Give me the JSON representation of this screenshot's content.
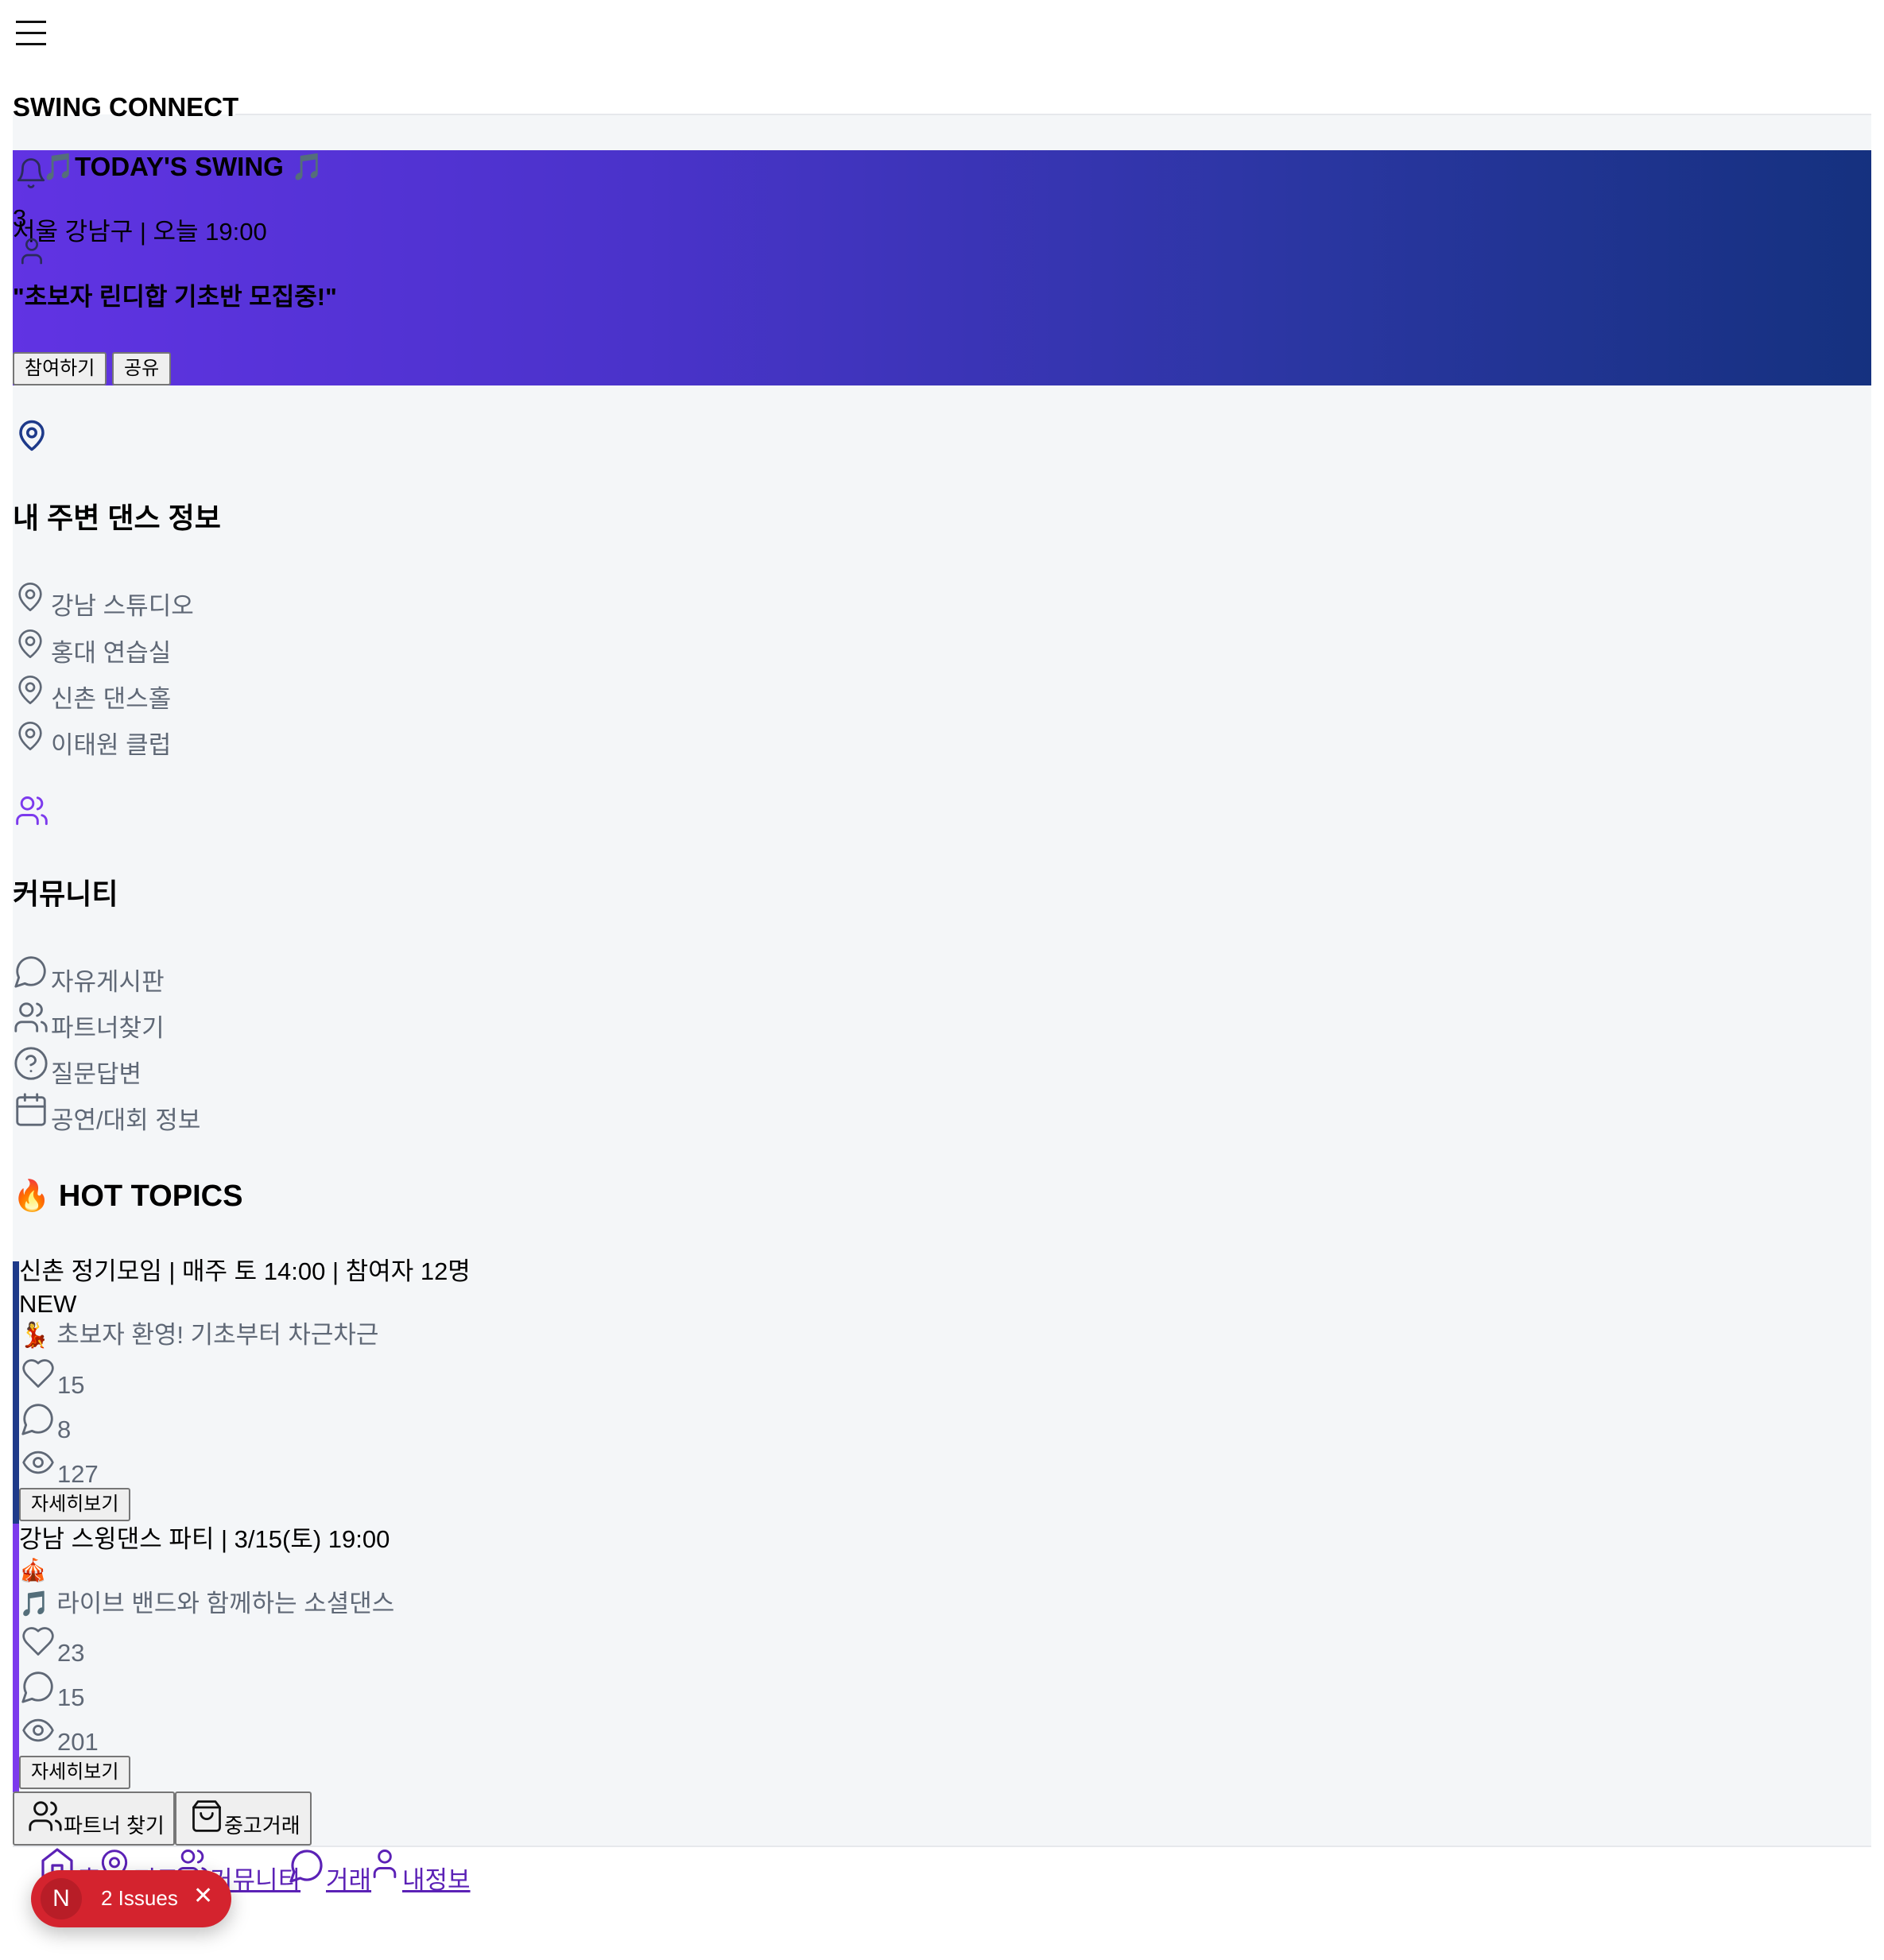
{
  "header": {
    "menu_icon": "hamburger-icon",
    "logo": "SWING CONNECT",
    "notification_count": "3"
  },
  "hero": {
    "title": "🎵TODAY'S SWING 🎵",
    "location_time": "서울 강남구 | 오늘 19:00",
    "headline": "\"초보자 린디합 기초반 모집중!\"",
    "join_label": "참여하기",
    "share_label": "공유",
    "gradient_start": "#6133e3",
    "gradient_end": "#15317f"
  },
  "nearby": {
    "title": "내 주변 댄스 정보",
    "icon": "map-pin-icon",
    "items": [
      {
        "label": "강남 스튜디오"
      },
      {
        "label": "홍대 연습실"
      },
      {
        "label": "신촌 댄스홀"
      },
      {
        "label": "이태원 클럽"
      }
    ]
  },
  "community": {
    "title": "커뮤니티",
    "icon": "users-icon",
    "items": [
      {
        "label": "자유게시판",
        "icon": "message-circle-icon"
      },
      {
        "label": "파트너찾기",
        "icon": "users-icon"
      },
      {
        "label": "질문답변",
        "icon": "help-circle-icon"
      },
      {
        "label": "공연/대회 정보",
        "icon": "calendar-icon"
      }
    ]
  },
  "hot_topics": {
    "title": "🔥 HOT TOPICS",
    "posts": [
      {
        "title": "신촌 정기모임 | 매주 토 14:00 | 참여자 12명",
        "badge": "NEW",
        "description": "💃 초보자 환영! 기초부터 차근차근",
        "likes": "15",
        "comments": "8",
        "views": "127",
        "detail_label": "자세히보기",
        "accent": "#1e3a8a"
      },
      {
        "title": "강남 스윙댄스 파티 | 3/15(토) 19:00",
        "badge": "🎪",
        "description": "🎵 라이브 밴드와 함께하는 소셜댄스",
        "likes": "23",
        "comments": "15",
        "views": "201",
        "detail_label": "자세히보기",
        "accent": "#7c3aed"
      }
    ]
  },
  "quick_actions": {
    "partner_label": "파트너 찾기",
    "market_label": "중고거래"
  },
  "bottom_nav": {
    "items": [
      {
        "label": "홈",
        "icon": "home-icon"
      },
      {
        "label": "지도",
        "icon": "map-pin-icon"
      },
      {
        "label": "커뮤니티",
        "icon": "users-icon"
      },
      {
        "label": "거래",
        "icon": "message-circle-icon"
      },
      {
        "label": "내정보",
        "icon": "user-icon"
      }
    ]
  },
  "dev_overlay": {
    "letter": "N",
    "issues_label": "2 Issues"
  }
}
